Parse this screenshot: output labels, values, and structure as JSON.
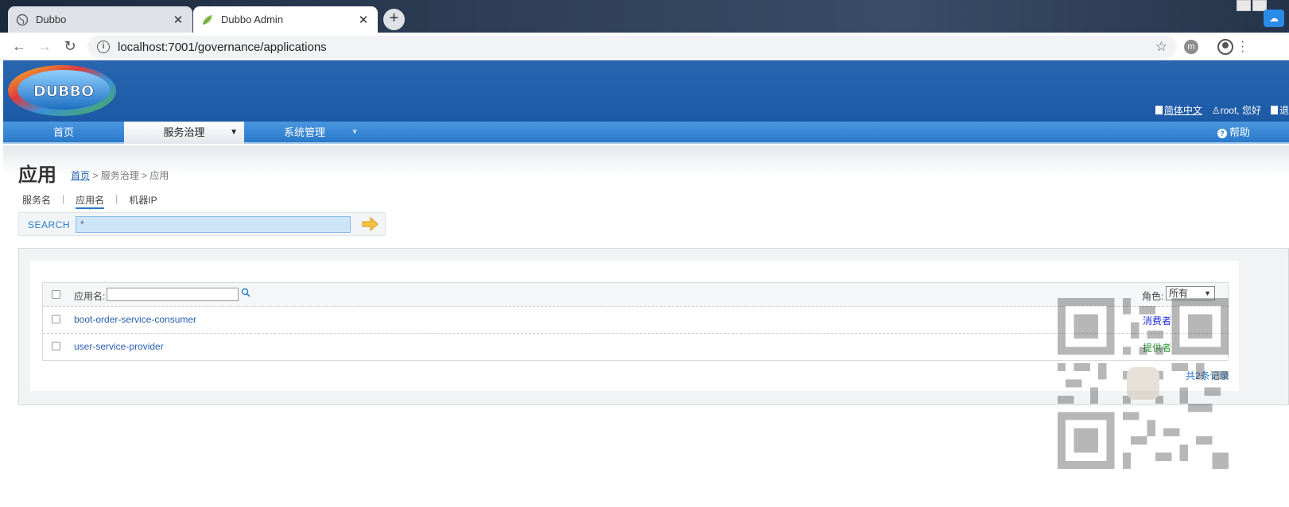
{
  "browser": {
    "tabs": [
      {
        "title": "Dubbo",
        "close": "✕"
      },
      {
        "title": "Dubbo Admin",
        "close": "✕"
      }
    ],
    "new_tab": "+",
    "url": "localhost:7001/governance/applications",
    "icons": [
      "globe-icon",
      "leaf-icon",
      "back-icon",
      "forward-icon",
      "reload-icon",
      "info-icon",
      "star-icon",
      "profile-icon"
    ]
  },
  "header": {
    "logo_text": "DUBBO",
    "links": [
      "简体中文",
      "root, 您好",
      "退"
    ]
  },
  "nav": {
    "home": "首页",
    "governance": "服务治理",
    "system": "系统管理",
    "help": "帮助",
    "arrow": "▼"
  },
  "page": {
    "title": "应用",
    "breadcrumb": {
      "home": "首页",
      "rest": " > 服务治理 > 应用"
    },
    "subtabs": [
      "服务名",
      "应用名",
      "机器IP"
    ],
    "subtab_sep": "|",
    "search_label": "SEARCH",
    "search_value": "*"
  },
  "grid": {
    "filter_label": "应用名:",
    "role_label": "角色:",
    "role_selected": "所有",
    "rows": [
      {
        "name": "boot-order-service-consumer",
        "role": "消费者"
      },
      {
        "name": "user-service-provider",
        "role": "提供者"
      }
    ],
    "total": "共2条记录"
  },
  "colors": {
    "header_blue": "#2866b0",
    "nav_blue": "#2a79c9",
    "consumer": "#1d2cd6",
    "provider": "#2e9a3a"
  }
}
